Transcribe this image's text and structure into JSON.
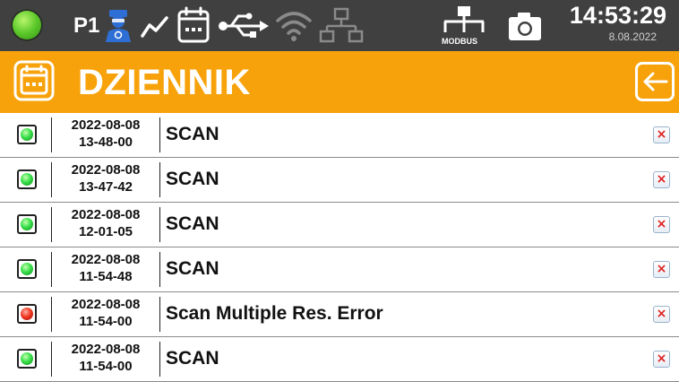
{
  "status_bar": {
    "status_led": "green",
    "profile_label": "P1",
    "icons": [
      "user-avatar-icon",
      "trend-chart-icon",
      "calendar-icon",
      "usb-icon",
      "wifi-icon",
      "network-icon",
      "modbus-icon",
      "camera-icon"
    ],
    "modbus_label": "MODBUS",
    "time": "14:53:29",
    "date": "8.08.2022",
    "colors": {
      "bar": "#404040",
      "avatar": "#2e6fd6",
      "wifi_inactive": "#8a8a8a"
    }
  },
  "title_bar": {
    "title": "DZIENNIK",
    "colors": {
      "bar": "#f7a20a",
      "text": "#ffffff"
    }
  },
  "log": {
    "rows": [
      {
        "date": "2022-08-08",
        "time": "13-48-00",
        "message": "SCAN",
        "status": "ok"
      },
      {
        "date": "2022-08-08",
        "time": "13-47-42",
        "message": "SCAN",
        "status": "ok"
      },
      {
        "date": "2022-08-08",
        "time": "12-01-05",
        "message": "SCAN",
        "status": "ok"
      },
      {
        "date": "2022-08-08",
        "time": "11-54-48",
        "message": "SCAN",
        "status": "ok"
      },
      {
        "date": "2022-08-08",
        "time": "11-54-00",
        "message": "Scan Multiple Res. Error",
        "status": "error"
      },
      {
        "date": "2022-08-08",
        "time": "11-54-00",
        "message": "SCAN",
        "status": "ok"
      }
    ],
    "delete_glyph": "×"
  }
}
